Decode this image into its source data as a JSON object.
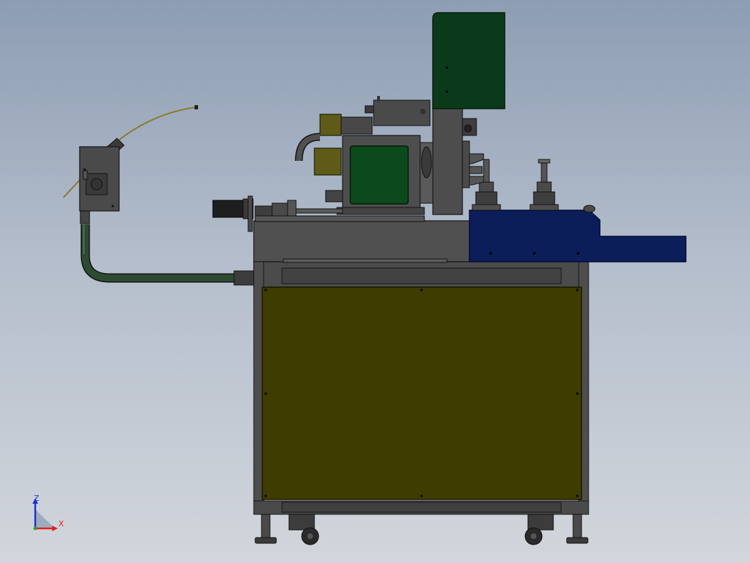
{
  "triad": {
    "z_label": "Z",
    "x_label": "X",
    "colors": {
      "z_axis": "#1a2fd6",
      "x_axis": "#e02020",
      "y_axis": "#2aa02a"
    }
  },
  "colors": {
    "background_top": "#8d9db3",
    "background_bottom": "#d2d6dc",
    "frame": "#4a4a4a",
    "frame_dark": "#333333",
    "guard_panel": "#3f3c00",
    "tray": "#0b1e5a",
    "monitor": "#0a3a1a",
    "head_face": "#0c4a1c",
    "yellow_block": "#5e5a18",
    "hose": "#2f4a33"
  }
}
